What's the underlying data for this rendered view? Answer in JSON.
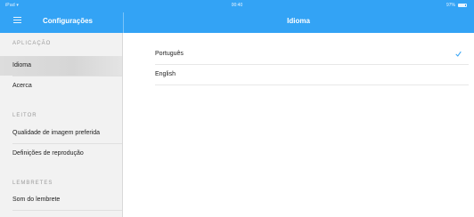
{
  "status_bar": {
    "device": "iPad",
    "time": "00:40",
    "battery": "97%"
  },
  "sidebar": {
    "title": "Configurações",
    "sections": [
      {
        "header": "APLICAÇÃO",
        "items": [
          {
            "label": "Idioma",
            "selected": true
          },
          {
            "label": "Acerca",
            "selected": false
          }
        ]
      },
      {
        "header": "LEITOR",
        "items": [
          {
            "label": "Qualidade de imagem preferida",
            "selected": false
          },
          {
            "label": "Definições de reprodução",
            "selected": false
          }
        ]
      },
      {
        "header": "LEMBRETES",
        "items": [
          {
            "label": "Som do lembrete",
            "selected": false
          }
        ]
      }
    ]
  },
  "main": {
    "title": "Idioma",
    "options": [
      {
        "label": "Português",
        "checked": true
      },
      {
        "label": "English",
        "checked": false
      }
    ]
  },
  "colors": {
    "accent": "#33a3f5",
    "sidebar_bg": "#f2f2f2",
    "selected_bg": "#dddddd",
    "check": "#33a3f5"
  },
  "icons": {
    "menu": "hamburger-menu-icon",
    "check": "checkmark-icon",
    "wifi": "wifi-icon",
    "battery": "battery-icon"
  }
}
